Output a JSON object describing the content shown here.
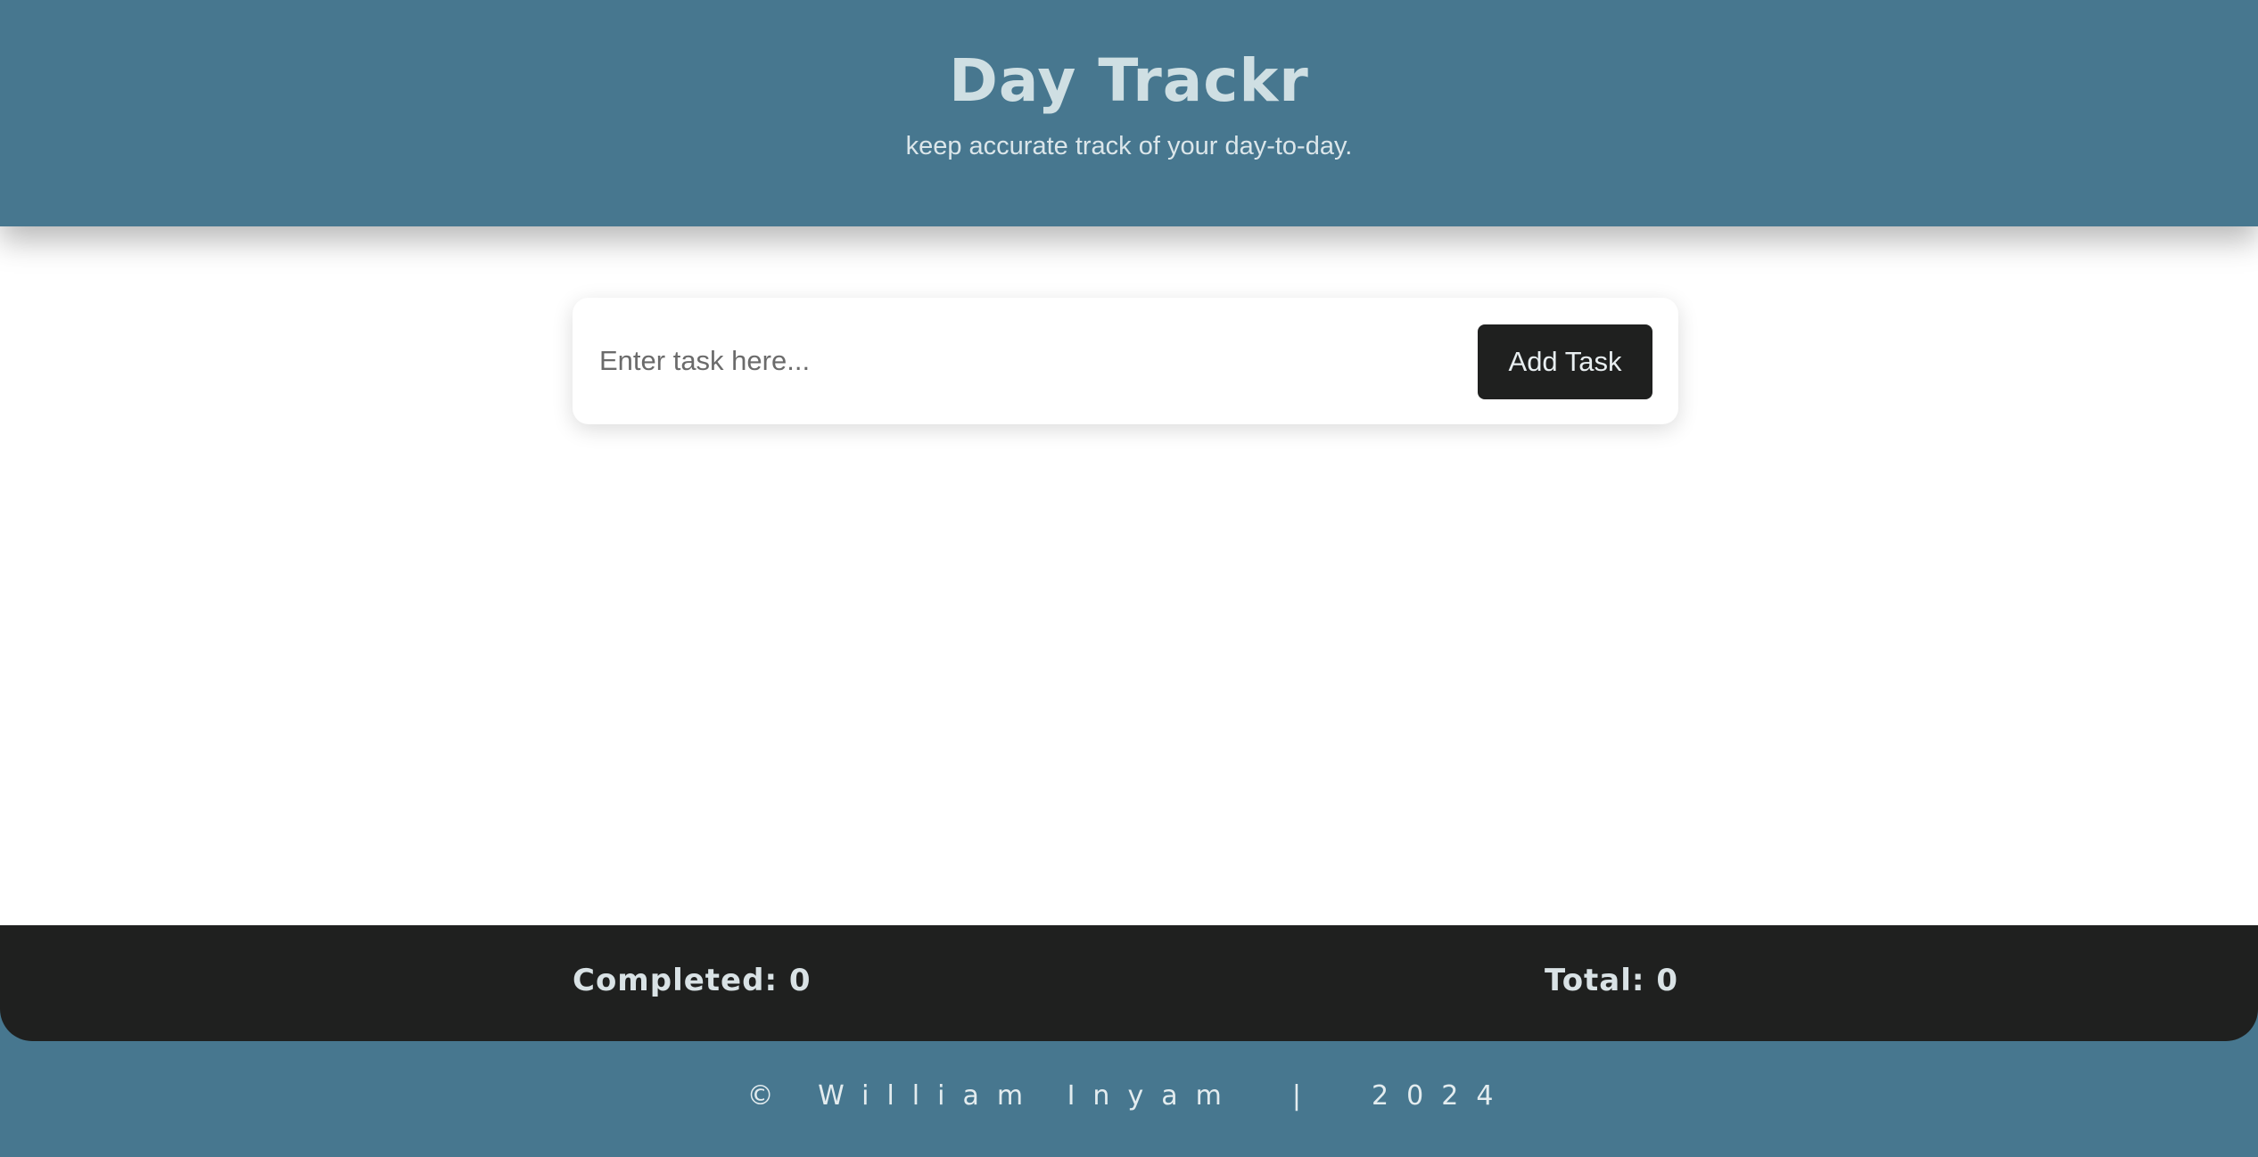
{
  "header": {
    "title": "Day Trackr",
    "subtitle": "keep accurate track of your day-to-day."
  },
  "task_form": {
    "input_value": "",
    "placeholder": "Enter task here...",
    "add_button_label": "Add Task"
  },
  "tasks": [],
  "stats": {
    "completed_text": "Completed: 0",
    "total_text": "Total: 0"
  },
  "footer": {
    "credit": "© William Inyam  |  2024"
  },
  "colors": {
    "header_bg": "#47778f",
    "dark_bar": "#1f201f",
    "title_text": "#cfdfe3"
  }
}
